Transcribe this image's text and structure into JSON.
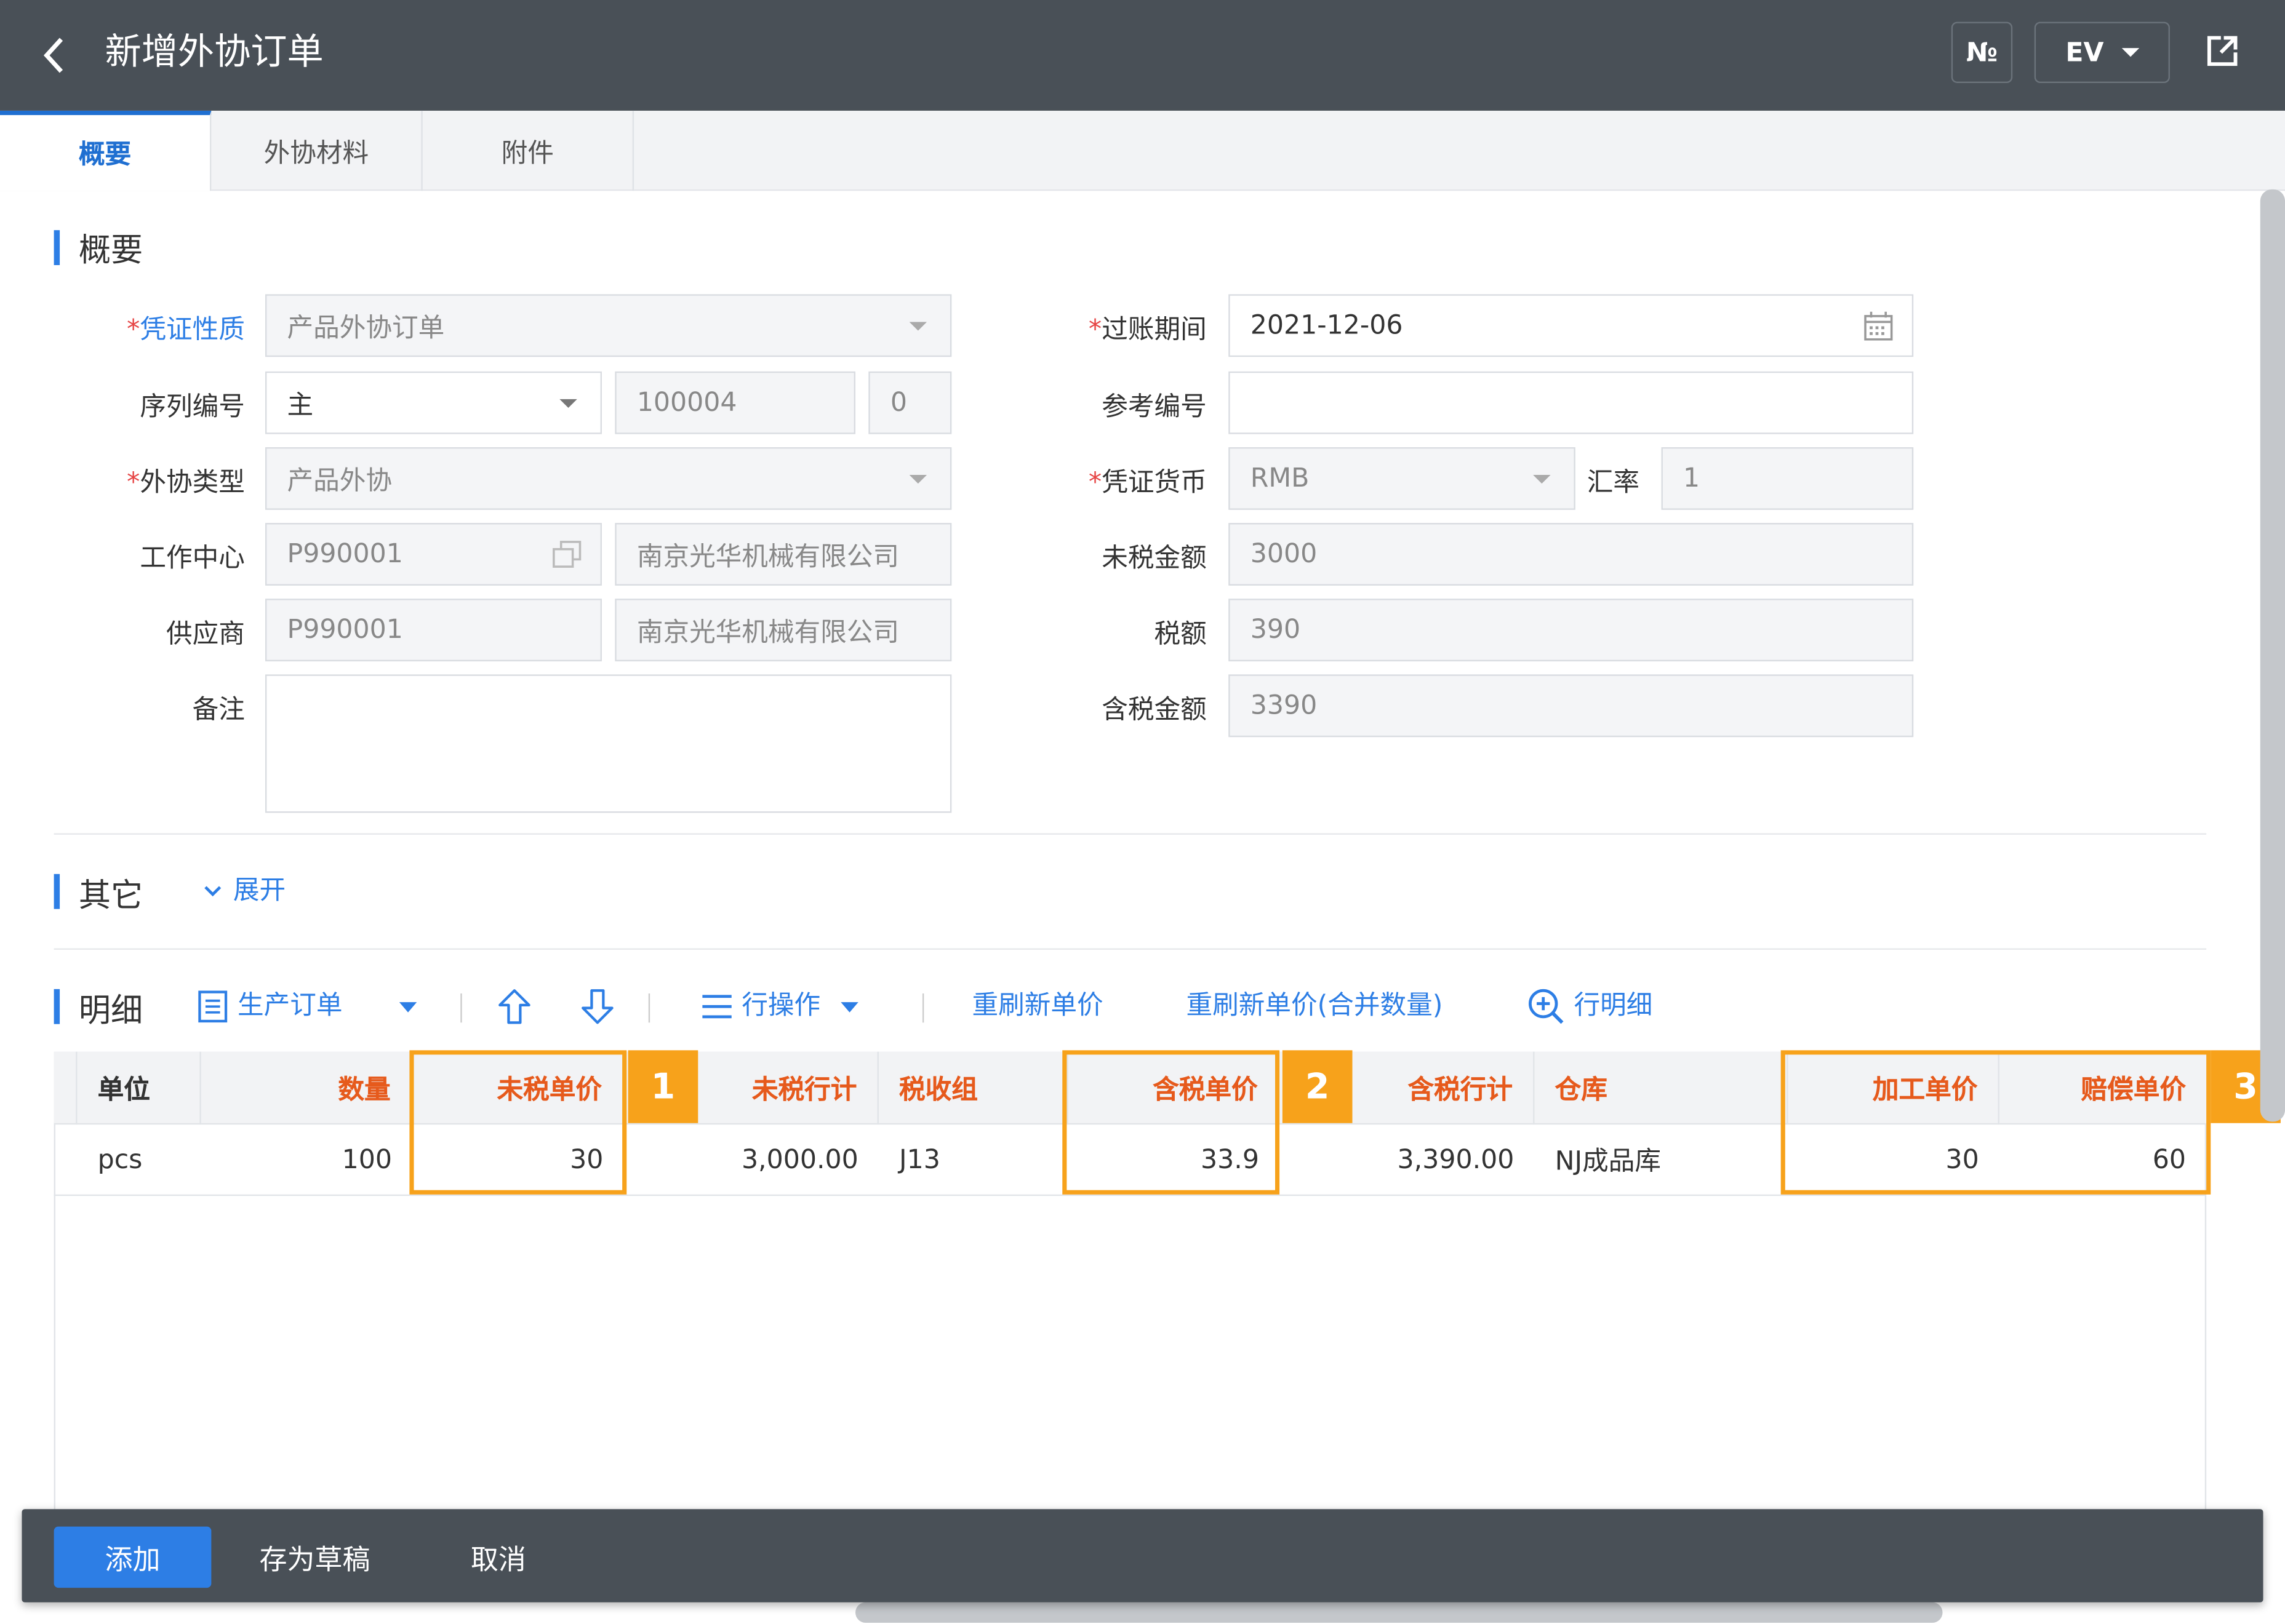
{
  "header": {
    "back_icon": "chevron-left-icon",
    "title": "新增外协订单",
    "no_button": "№",
    "ev_button": "EV",
    "export_icon": "share-external-icon"
  },
  "tabs": [
    {
      "label": "概要",
      "active": true
    },
    {
      "label": "外协材料"
    },
    {
      "label": "附件"
    }
  ],
  "overview": {
    "section_title": "概要",
    "voucher_type": {
      "label": "凭证性质",
      "value": "产品外协订单"
    },
    "serial": {
      "label": "序列编号",
      "value": "主",
      "number": "100004",
      "suffix": "0"
    },
    "outsource_type": {
      "label": "外协类型",
      "value": "产品外协"
    },
    "work_center": {
      "label": "工作中心",
      "code": "P990001",
      "name": "南京光华机械有限公司"
    },
    "supplier": {
      "label": "供应商",
      "code": "P990001",
      "name": "南京光华机械有限公司"
    },
    "remark": {
      "label": "备注",
      "value": ""
    },
    "posting_period": {
      "label": "过账期间",
      "value": "2021-12-06"
    },
    "reference": {
      "label": "参考编号",
      "value": ""
    },
    "currency": {
      "label": "凭证货币",
      "value": "RMB",
      "rate_label": "汇率",
      "rate": "1"
    },
    "net_amount": {
      "label": "未税金额",
      "value": "3000"
    },
    "tax": {
      "label": "税额",
      "value": "390"
    },
    "gross_amount": {
      "label": "含税金额",
      "value": "3390"
    }
  },
  "other": {
    "section_title": "其它",
    "expand": "展开"
  },
  "detail": {
    "section_title": "明细",
    "toolbar": {
      "production_order": "生产订单",
      "row_ops": "行操作",
      "refresh_price": "重刷新单价",
      "refresh_price_merge": "重刷新单价(合并数量)",
      "row_detail": "行明细"
    },
    "columns": {
      "unit": "单位",
      "qty": "数量",
      "net_price": "未税单价",
      "net_total": "未税行计",
      "tax_group": "税收组",
      "gross_price": "含税单价",
      "gross_total": "含税行计",
      "warehouse": "仓库",
      "process_price": "加工单价",
      "comp_price": "赔偿单价"
    },
    "rows": [
      {
        "unit": "pcs",
        "qty": "100",
        "net_price": "30",
        "net_total": "3,000.00",
        "tax_group": "J13",
        "gross_price": "33.9",
        "gross_total": "3,390.00",
        "warehouse": "NJ成品库",
        "process_price": "30",
        "comp_price": "60"
      }
    ],
    "badges": [
      "1",
      "2",
      "3"
    ]
  },
  "footer": {
    "add": "添加",
    "save_draft": "存为草稿",
    "cancel": "取消"
  },
  "colors": {
    "topbar": "#495057",
    "accent": "#2d7ee5",
    "highlight": "#f7a21b",
    "header_text": "#e65a1c"
  }
}
